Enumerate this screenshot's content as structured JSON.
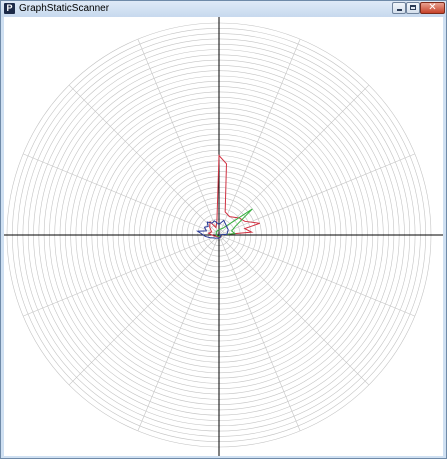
{
  "window": {
    "title": "GraphStaticScanner",
    "app_icon_glyph": "P",
    "close_glyph": "✕",
    "icons": {
      "app": "processing-app-icon",
      "minimize": "minimize-icon",
      "maximize": "maximize-icon",
      "close": "close-icon"
    }
  },
  "chart_data": {
    "type": "polar-line",
    "grid": true,
    "ring_count": 40,
    "spoke_angles_deg": [
      0,
      22.5,
      45,
      67.5,
      90,
      112.5,
      135,
      157.5,
      180,
      202.5,
      225,
      247.5,
      270,
      292.5,
      315,
      337.5
    ],
    "colors": {
      "grid": "#c4c4c4",
      "axes": "#000000",
      "background": "#ffffff"
    },
    "series": [
      {
        "color": "#d03040",
        "points": [
          [
            0,
            0
          ],
          [
            5,
            6.2
          ],
          [
            14,
            5
          ],
          [
            16,
            8
          ],
          [
            28,
            5.5
          ],
          [
            40,
            5
          ],
          [
            60,
            4
          ],
          [
            75,
            4.5
          ],
          [
            84,
            13.5
          ],
          [
            90,
            15
          ],
          [
            98,
            2.8
          ],
          [
            112,
            1.5
          ],
          [
            124,
            3
          ],
          [
            140,
            2.3
          ],
          [
            158,
            1.5
          ],
          [
            170,
            2
          ],
          [
            190,
            1
          ],
          [
            210,
            0.5
          ],
          [
            250,
            0.4
          ],
          [
            300,
            0.5
          ],
          [
            340,
            0.5
          ],
          [
            355,
            0.2
          ]
        ]
      },
      {
        "color": "#38b040",
        "points": [
          [
            0,
            0
          ],
          [
            5,
            3
          ],
          [
            18,
            2.5
          ],
          [
            28,
            3.5
          ],
          [
            38,
            8
          ],
          [
            46,
            3
          ],
          [
            60,
            1.5
          ],
          [
            90,
            1
          ],
          [
            130,
            0.8
          ],
          [
            180,
            0.5
          ],
          [
            250,
            0.3
          ],
          [
            320,
            0.4
          ],
          [
            355,
            0.2
          ]
        ]
      },
      {
        "color": "#283898",
        "points": [
          [
            0,
            0
          ],
          [
            5,
            1.5
          ],
          [
            30,
            2
          ],
          [
            55,
            2.3
          ],
          [
            72,
            2.9
          ],
          [
            90,
            2
          ],
          [
            108,
            2.8
          ],
          [
            120,
            2.6
          ],
          [
            132,
            3.3
          ],
          [
            142,
            2.6
          ],
          [
            152,
            3.1
          ],
          [
            162,
            2.5
          ],
          [
            170,
            4.1
          ],
          [
            177,
            3.2
          ],
          [
            186,
            2.6
          ],
          [
            196,
            1.8
          ],
          [
            220,
            0.9
          ],
          [
            260,
            0.6
          ],
          [
            300,
            0.5
          ],
          [
            340,
            0.4
          ],
          [
            355,
            0.2
          ]
        ]
      }
    ]
  }
}
